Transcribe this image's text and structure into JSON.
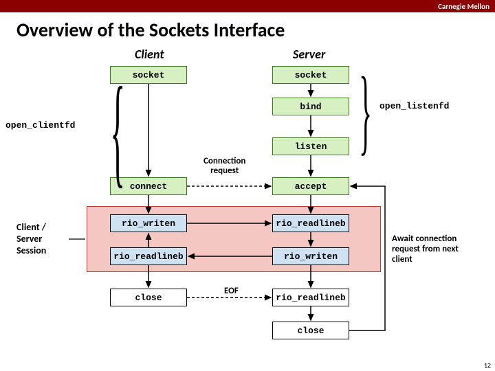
{
  "header": {
    "brand": "Carnegie Mellon",
    "title": "Overview of the Sockets Interface"
  },
  "columns": {
    "client": "Client",
    "server": "Server"
  },
  "boxes": {
    "c_socket": "socket",
    "s_socket": "socket",
    "s_bind": "bind",
    "s_listen": "listen",
    "c_connect": "connect",
    "s_accept": "accept",
    "c_riow": "rio_writen",
    "s_rior": "rio_readlineb",
    "c_rior": "rio_readlineb",
    "s_riow": "rio_writen",
    "c_close": "close",
    "s_rior2": "rio_readlineb",
    "s_close": "close"
  },
  "labels": {
    "open_clientfd": "open_clientfd",
    "open_listenfd": "open_listenfd",
    "conn_req": "Connection\nrequest",
    "eof": "EOF",
    "session": "Client /\nServer\nSession",
    "await": "Await connection request from next client"
  },
  "page": "12"
}
